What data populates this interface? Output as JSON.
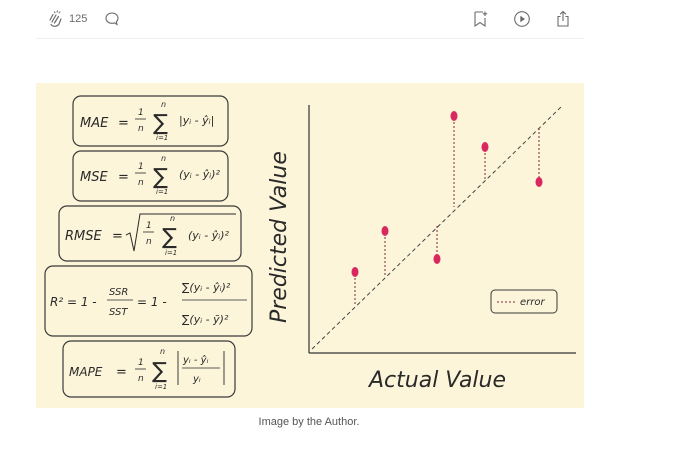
{
  "toolbar": {
    "clap_count": "125",
    "icons": [
      "clap-icon",
      "comment-icon",
      "bookmark-add-icon",
      "play-icon",
      "share-icon"
    ]
  },
  "figure": {
    "formulas": {
      "mae": {
        "lhs": "MAE",
        "frac_num": "1",
        "frac_den": "n",
        "sum_top": "n",
        "sum_bottom": "i=1",
        "term": "|yᵢ - ŷᵢ|"
      },
      "mse": {
        "lhs": "MSE",
        "frac_num": "1",
        "frac_den": "n",
        "sum_top": "n",
        "sum_bottom": "i=1",
        "term": "(yᵢ - ŷᵢ)²"
      },
      "rmse": {
        "lhs": "RMSE",
        "frac_num": "1",
        "frac_den": "n",
        "sum_top": "n",
        "sum_bottom": "i=1",
        "term": "(yᵢ - ŷᵢ)²"
      },
      "r2": {
        "lhs": "R² = 1 -",
        "ssr": "SSR",
        "sst": "SST",
        "mid": "= 1 -",
        "num_term": "∑(yᵢ - ŷᵢ)²",
        "den_term": "∑(yᵢ - ȳ)²"
      },
      "mape": {
        "lhs": "MAPE",
        "frac_num": "1",
        "frac_den": "n",
        "sum_top": "n",
        "sum_bottom": "i=1",
        "num": "yᵢ - ŷᵢ",
        "den": "yᵢ"
      }
    },
    "plot": {
      "y_label": "Predicted Value",
      "x_label": "Actual Value",
      "legend": "error",
      "point_color": "#d9285f"
    }
  },
  "caption": "Image by the Author."
}
